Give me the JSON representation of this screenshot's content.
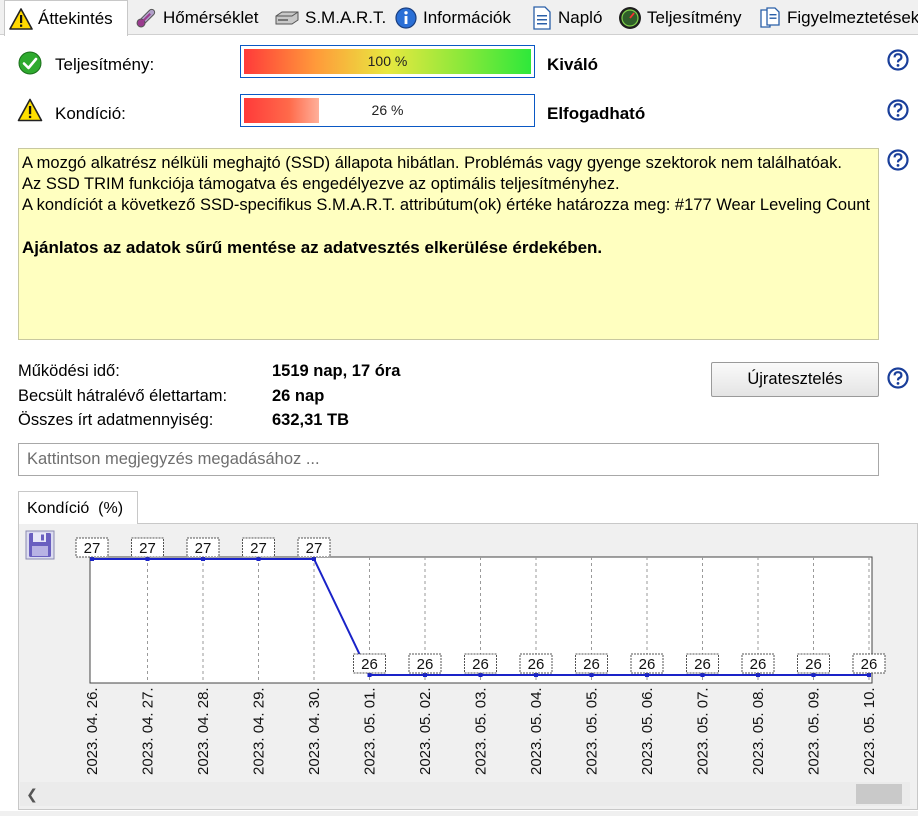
{
  "tabs": [
    {
      "label": "Áttekintés",
      "icon": "warning-icon",
      "active": true
    },
    {
      "label": "Hőmérséklet",
      "icon": "thermometer-icon",
      "active": false
    },
    {
      "label": "S.M.A.R.T.",
      "icon": "drive-icon",
      "active": false
    },
    {
      "label": "Információk",
      "icon": "info-icon",
      "active": false
    },
    {
      "label": "Napló",
      "icon": "log-icon",
      "active": false
    },
    {
      "label": "Teljesítmény",
      "icon": "gauge-icon",
      "active": false
    },
    {
      "label": "Figyelmeztetések",
      "icon": "alerts-icon",
      "active": false
    }
  ],
  "status": {
    "performance": {
      "label": "Teljesítmény:",
      "percent": 100,
      "percent_text": "100 %",
      "verdict": "Kiváló",
      "icon": "ok-check-icon"
    },
    "health": {
      "label": "Kondíció:",
      "percent": 26,
      "percent_text": "26 %",
      "verdict": "Elfogadható",
      "icon": "warning-icon"
    }
  },
  "info": {
    "lines": [
      "A mozgó alkatrész nélküli meghajtó (SSD) állapota hibátlan. Problémás vagy gyenge szektorok nem találhatóak.",
      "Az SSD TRIM funkciója támogatva és engedélyezve az optimális teljesítményhez.",
      "A kondíciót a következő SSD-specifikus S.M.A.R.T. attribútum(ok) értéke határozza meg:  #177 Wear Leveling Count"
    ],
    "recommendation": "Ajánlatos az adatok sűrű mentése az adatvesztés elkerülése érdekében."
  },
  "stats": {
    "uptime": {
      "label": "Működési idő:",
      "value": "1519 nap, 17 óra"
    },
    "remaining": {
      "label": "Becsült hátralévő élettartam:",
      "value": "26 nap"
    },
    "written": {
      "label": "Összes írt adatmennyiség:",
      "value": "632,31 TB"
    }
  },
  "retest_label": "Újratesztelés",
  "note_placeholder": "Kattintson megjegyzés megadásához ...",
  "chart_tab_label": "Kondíció  (%)",
  "colors": {
    "accent_blue": "#0a58c4",
    "info_bg": "#ffffc0",
    "series_line": "#1a23c8"
  },
  "chart_data": {
    "type": "line",
    "title": "",
    "xlabel": "",
    "ylabel": "",
    "categories": [
      "2023. 04. 26.",
      "2023. 04. 27.",
      "2023. 04. 28.",
      "2023. 04. 29.",
      "2023. 04. 30.",
      "2023. 05. 01.",
      "2023. 05. 02.",
      "2023. 05. 03.",
      "2023. 05. 04.",
      "2023. 05. 05.",
      "2023. 05. 06.",
      "2023. 05. 07.",
      "2023. 05. 08.",
      "2023. 05. 09.",
      "2023. 05. 10."
    ],
    "values": [
      27,
      27,
      27,
      27,
      27,
      26,
      26,
      26,
      26,
      26,
      26,
      26,
      26,
      26,
      26
    ],
    "ylim": [
      26,
      27
    ],
    "grid": "vertical-dashed",
    "legend": "none"
  }
}
